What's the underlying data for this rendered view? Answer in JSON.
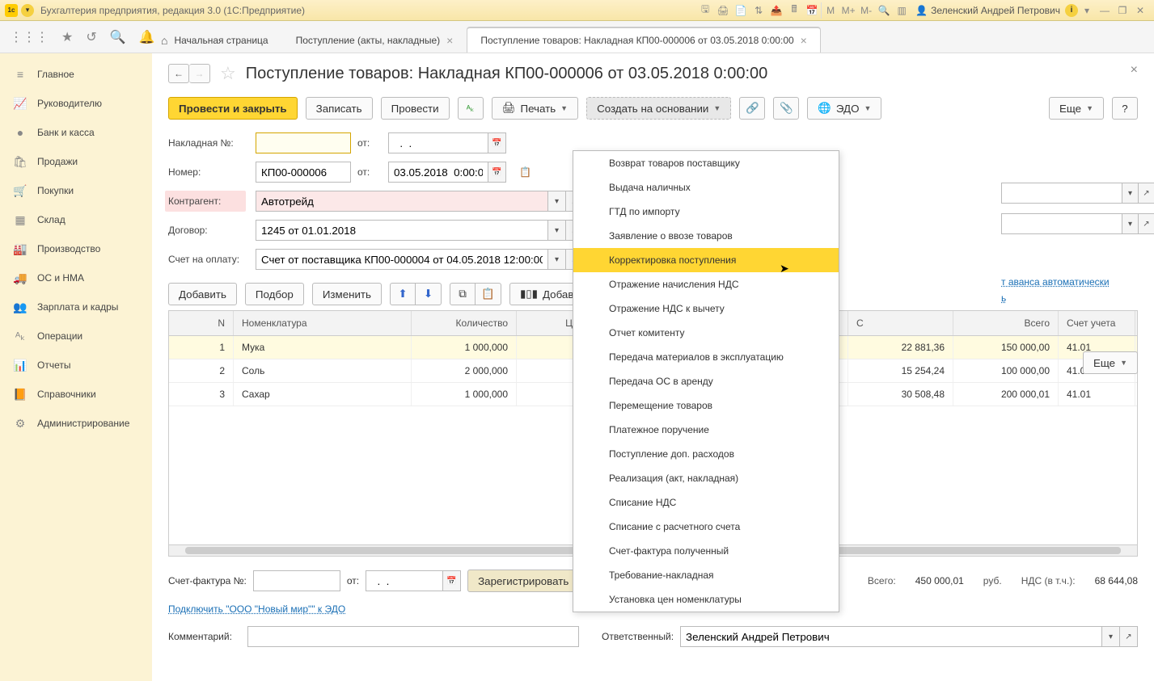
{
  "app": {
    "title": "Бухгалтерия предприятия, редакция 3.0  (1С:Предприятие)",
    "user": "Зеленский Андрей Петрович"
  },
  "toolbar_markers": {
    "m1": "М",
    "m2": "М+",
    "m3": "М-"
  },
  "tabs": {
    "home": "Начальная страница",
    "t1": "Поступление (акты, накладные)",
    "t2": "Поступление товаров: Накладная КП00-000006 от 03.05.2018 0:00:00"
  },
  "sidebar": {
    "main": "Главное",
    "manager": "Руководителю",
    "bank": "Банк и касса",
    "sales": "Продажи",
    "purchases": "Покупки",
    "warehouse": "Склад",
    "production": "Производство",
    "assets": "ОС и НМА",
    "salary": "Зарплата и кадры",
    "operations": "Операции",
    "reports": "Отчеты",
    "catalogs": "Справочники",
    "admin": "Администрирование"
  },
  "page": {
    "title": "Поступление товаров: Накладная КП00-000006 от 03.05.2018 0:00:00"
  },
  "actions": {
    "post_close": "Провести и закрыть",
    "save": "Записать",
    "post": "Провести",
    "print": "Печать",
    "create_based": "Создать на основании",
    "edo": "ЭДО",
    "more": "Еще",
    "help": "?"
  },
  "form": {
    "invoice_label": "Накладная №:",
    "invoice_value": "",
    "from_label": "от:",
    "invoice_date": "  .  .",
    "number_label": "Номер:",
    "number_value": "КП00-000006",
    "number_date": "03.05.2018  0:00:00",
    "counterparty_label": "Контрагент:",
    "counterparty_value": "Автотрейд",
    "contract_label": "Договор:",
    "contract_value": "1245 от 01.01.2018",
    "bill_label": "Счет на оплату:",
    "bill_value": "Счет от поставщика КП00-000004 от 04.05.2018 12:00:00",
    "advance_link": "т аванса автоматически",
    "tax_link": "ь"
  },
  "table_tools": {
    "add": "Добавить",
    "select": "Подбор",
    "edit": "Изменить",
    "add_by": "Добавить",
    "more": "Еще"
  },
  "table": {
    "headers": {
      "n": "N",
      "nomenclature": "Номенклатура",
      "qty": "Количество",
      "price": "Цена",
      "nds_col": "С",
      "total": "Всего",
      "account": "Счет учета"
    },
    "rows": [
      {
        "n": "1",
        "nom": "Мука",
        "qty": "1 000,000",
        "price": "",
        "nds": "22 881,36",
        "total": "150 000,00",
        "acc": "41.01"
      },
      {
        "n": "2",
        "nom": "Соль",
        "qty": "2 000,000",
        "price": "",
        "nds": "15 254,24",
        "total": "100 000,00",
        "acc": "41.01"
      },
      {
        "n": "3",
        "nom": "Сахар",
        "qty": "1 000,000",
        "price": "",
        "nds": "30 508,48",
        "total": "200 000,01",
        "acc": "41.01"
      }
    ]
  },
  "invoice_bottom": {
    "label": "Счет-фактура №:",
    "value": "",
    "from": "от:",
    "date": "  .  .",
    "register": "Зарегистрировать"
  },
  "totals": {
    "total_label": "Всего:",
    "total_value": "450 000,01",
    "currency": "руб.",
    "nds_label": "НДС (в т.ч.):",
    "nds_value": "68 644,08"
  },
  "edo_link": "Подключить \"ООО \"Новый мир\"\" к ЭДО",
  "comment": {
    "label": "Комментарий:",
    "value": ""
  },
  "responsible": {
    "label": "Ответственный:",
    "value": "Зеленский Андрей Петрович"
  },
  "dropdown": {
    "items": [
      "Возврат товаров поставщику",
      "Выдача наличных",
      "ГТД по импорту",
      "Заявление о ввозе товаров",
      "Корректировка поступления",
      "Отражение начисления НДС",
      "Отражение НДС к вычету",
      "Отчет комитенту",
      "Передача материалов в эксплуатацию",
      "Передача ОС в аренду",
      "Перемещение товаров",
      "Платежное поручение",
      "Поступление доп. расходов",
      "Реализация (акт, накладная)",
      "Списание НДС",
      "Списание с расчетного счета",
      "Счет-фактура полученный",
      "Требование-накладная",
      "Установка цен номенклатуры"
    ],
    "highlighted_index": 4
  }
}
